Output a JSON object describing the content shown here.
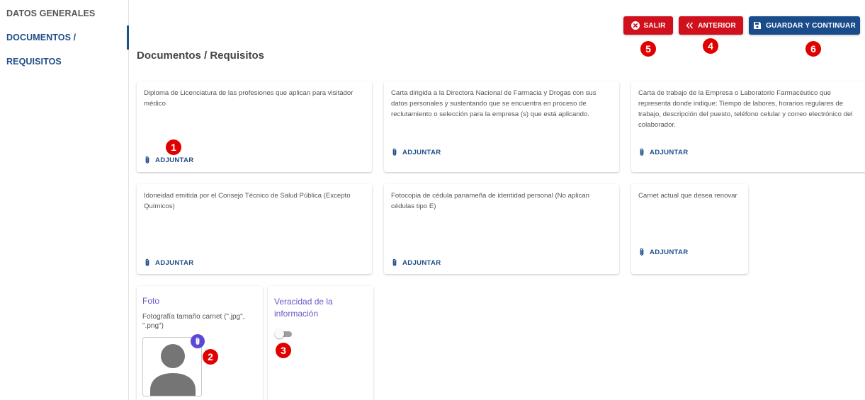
{
  "sidebar": {
    "items": [
      {
        "label": "DATOS GENERALES",
        "active": false
      },
      {
        "label": "DOCUMENTOS / REQUISITOS",
        "active": true
      }
    ]
  },
  "header": {
    "title": "Documentos / Requisitos",
    "buttons": {
      "salir": "SALIR",
      "anterior": "ANTERIOR",
      "guardar": "GUARDAR Y CONTINUAR"
    }
  },
  "callouts": [
    "1",
    "2",
    "3",
    "4",
    "5",
    "6"
  ],
  "documents": [
    {
      "text": "Diploma de Licenciatura de las profesiones que aplican para visitador médico",
      "action": "ADJUNTAR"
    },
    {
      "text": "Carta dirigida a la Directora Nacional de Farmacia y Drogas con sus datos personales y sustentando que se encuentra en proceso de reclutamiento o selección para la empresa (s) que está aplicando.",
      "action": "ADJUNTAR"
    },
    {
      "text": "Carta de trabajo de la Empresa o Laboratorio Farmacéutico que representa donde indique: Tiempo de labores, horarios regulares de trabajo, descripción del puesto, teléfono celular y correo electrónico del colaborador.",
      "action": "ADJUNTAR"
    },
    {
      "text": "Idoneidad emitida por el Consejo Técnico de Salud Pública (Excepto Químicos)",
      "action": "ADJUNTAR"
    },
    {
      "text": "Fotocopia de cédula panameña de identidad personal (No aplican cédulas tipo E)",
      "action": "ADJUNTAR"
    },
    {
      "text": "Carnet actual que desea renovar",
      "action": "ADJUNTAR"
    }
  ],
  "photo": {
    "label": "Foto",
    "description": "Fotografía tamaño carnet (\".jpg\", \".png\")"
  },
  "veracity": {
    "label": "Veracidad de la información",
    "toggle_on": false
  },
  "colors": {
    "primary": "#1a4c8b",
    "danger": "#d0101c",
    "accent": "#6b58c8",
    "callout": "#e00000"
  }
}
